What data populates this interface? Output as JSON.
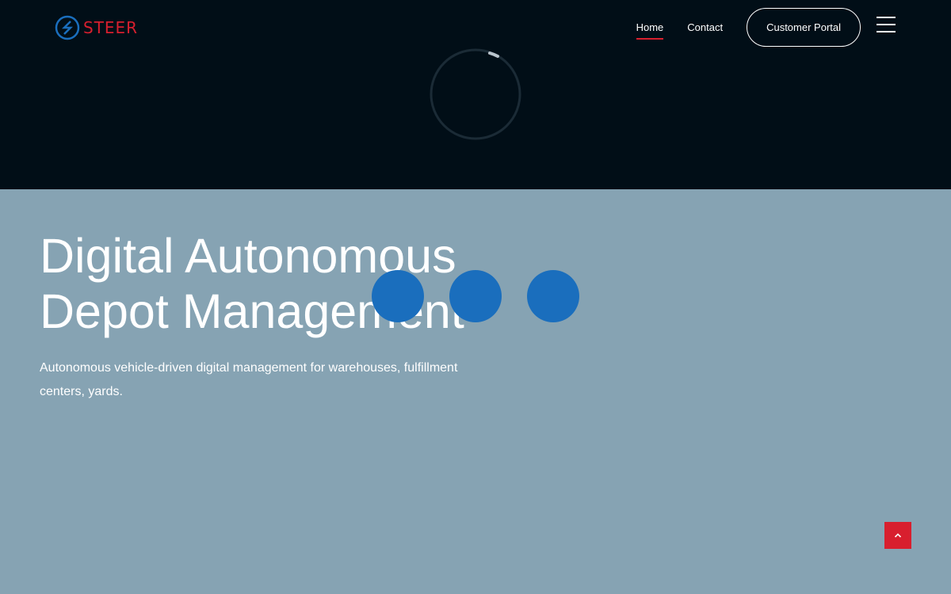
{
  "brand": {
    "name": "STEER",
    "accent": "#d81f2e",
    "logo_blue": "#1a6ebd"
  },
  "nav": {
    "items": [
      {
        "label": "Home",
        "active": true
      },
      {
        "label": "Contact",
        "active": false
      }
    ],
    "portal_label": "Customer Portal",
    "menu_icon": "hamburger-icon"
  },
  "hero": {
    "title_line1": "Digital Autonomous",
    "title_line2": "Depot Management",
    "subtitle": "Autonomous vehicle-driven digital management for warehouses, fulfillment centers, yards."
  },
  "loader": {
    "spinner_icon": "loading-spinner-icon",
    "dot_color": "#1a6ebd"
  },
  "scroll_top_icon": "chevron-up-icon",
  "colors": {
    "header_bg": "#010e17",
    "hero_bg": "#86a3b3"
  }
}
